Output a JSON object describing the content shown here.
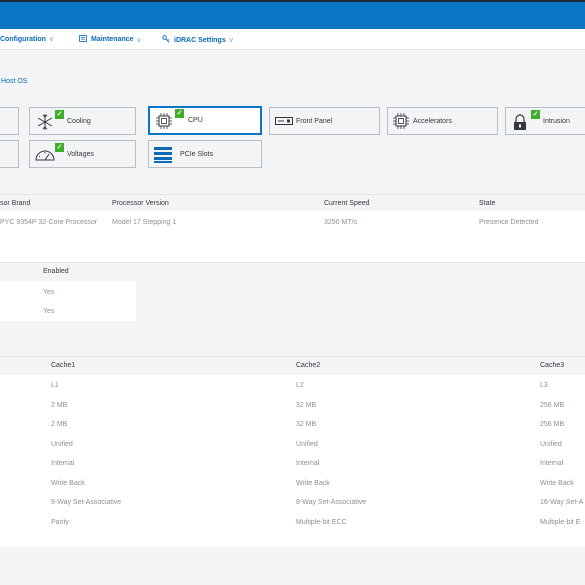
{
  "nav": {
    "items": [
      {
        "label": "Configuration",
        "icon": "none"
      },
      {
        "label": "Maintenance",
        "icon": "maintenance-icon"
      },
      {
        "label": "iDRAC Settings",
        "icon": "key-icon"
      }
    ],
    "chevron": "∨"
  },
  "breadcrumb": "Host OS",
  "tiles": {
    "cooling": "Cooling",
    "cpu": "CPU",
    "front_panel": "Front Panel",
    "accelerators": "Accelerators",
    "intrusion": "Intrusion",
    "voltages": "Voltages",
    "pcie_slots": "PCIe Slots",
    "check": "✓"
  },
  "processor_table": {
    "headers": {
      "brand": "sor Brand",
      "version": "Processor Version",
      "speed": "Current Speed",
      "state": "State"
    },
    "row": {
      "brand": "PYC 9354P 32-Core Processor",
      "version": "Model 17 Stepping 1",
      "speed": "3250 MT/s",
      "state": "Presence Detected"
    }
  },
  "enabled_table": {
    "header": "Enabled",
    "rows": [
      "Yes",
      "Yes"
    ]
  },
  "cache_table": {
    "headers": [
      "Cache1",
      "Cache2",
      "Cache3"
    ],
    "rows": [
      [
        "L1",
        "L2",
        "L3"
      ],
      [
        "2 MB",
        "32 MB",
        "256 MB"
      ],
      [
        "2 MB",
        "32 MB",
        "256 MB"
      ],
      [
        "Unified",
        "Unified",
        "Unified"
      ],
      [
        "Internal",
        "Internal",
        "Internal"
      ],
      [
        "Write Back",
        "Write Back",
        "Write Back"
      ],
      [
        "8-Way Set-Associative",
        "8-Way Set-Associative",
        "16-Way Set-A"
      ],
      [
        "Parity",
        "Multiple-bit ECC",
        "Multiple-bit E"
      ]
    ]
  },
  "colors": {
    "brand_blue": "#0a75c2",
    "ok_green": "#3fae29"
  }
}
